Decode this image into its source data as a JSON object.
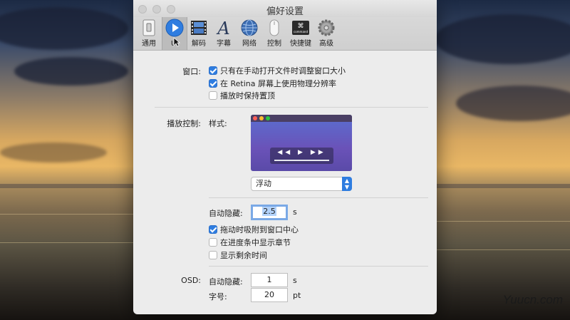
{
  "window": {
    "title": "偏好设置"
  },
  "toolbar": {
    "items": [
      {
        "label": "通用",
        "icon": "general-switch-icon"
      },
      {
        "label": "UI",
        "icon": "play-circle-icon"
      },
      {
        "label": "解码",
        "icon": "film-strip-icon"
      },
      {
        "label": "字幕",
        "icon": "font-a-icon"
      },
      {
        "label": "网络",
        "icon": "globe-icon"
      },
      {
        "label": "控制",
        "icon": "mouse-icon"
      },
      {
        "label": "快捷键",
        "icon": "command-key-icon"
      },
      {
        "label": "高级",
        "icon": "gear-icon"
      }
    ],
    "active_index": 1
  },
  "window_section": {
    "label": "窗口:",
    "options": [
      {
        "label": "只有在手动打开文件时调整窗口大小",
        "checked": true
      },
      {
        "label": "在 Retina 屏幕上使用物理分辨率",
        "checked": true
      },
      {
        "label": "播放时保持置顶",
        "checked": false
      }
    ]
  },
  "playback_control": {
    "label": "播放控制:",
    "style_label": "样式:",
    "style_value": "浮动",
    "preview_glyphs": "◀◀ ▶ ▶▶",
    "autohide_label": "自动隐藏:",
    "autohide_value": "2.5",
    "autohide_unit": "s",
    "options": [
      {
        "label": "拖动时吸附到窗口中心",
        "checked": true
      },
      {
        "label": "在进度条中显示章节",
        "checked": false
      },
      {
        "label": "显示剩余时间",
        "checked": false
      }
    ]
  },
  "osd": {
    "label": "OSD:",
    "autohide_label": "自动隐藏:",
    "autohide_value": "1",
    "autohide_unit": "s",
    "fontsize_label": "字号:",
    "fontsize_value": "20",
    "fontsize_unit": "pt"
  },
  "colors": {
    "accent": "#2f7de0",
    "window_bg": "#ececec",
    "preview_purple": "#6a52b8"
  },
  "watermark": "Yuucn.com"
}
